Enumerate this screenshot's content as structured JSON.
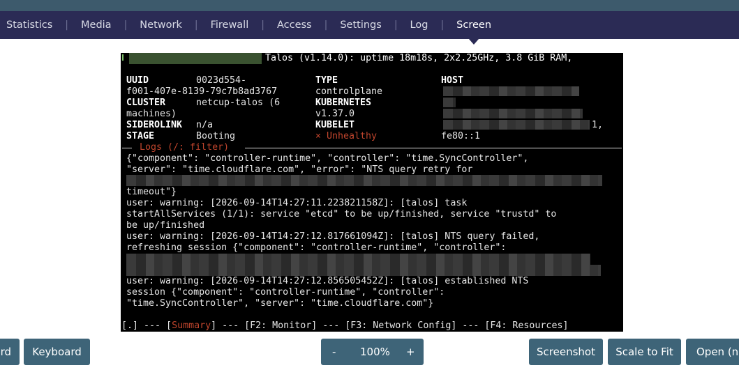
{
  "nav": {
    "items": [
      "Statistics",
      "Media",
      "Network",
      "Firewall",
      "Access",
      "Settings",
      "Log",
      "Screen"
    ],
    "active": "Screen",
    "colors": {
      "bar": "#2b2b55",
      "strip": "#3d5a6c"
    }
  },
  "console": {
    "header": "Talos (v1.14.0): uptime 18m18s, 2x2.25GHz, 3.8 GiB RAM,",
    "uuid_label": "UUID",
    "uuid_value_1": "0023d554-",
    "uuid_value_2": "f001-407e-8139-79c7b8ad3767",
    "cluster_label": "CLUSTER",
    "cluster_value_1": "netcup-talos (6",
    "cluster_value_2": "machines)",
    "siderolink_label": "SIDEROLINK",
    "siderolink_value": "n/a",
    "stage_label": "STAGE",
    "stage_value": "Booting",
    "type_label": "TYPE",
    "type_value": "controlplane",
    "kubernetes_label": "KUBERNETES",
    "kubernetes_value": "v1.37.0",
    "kubelet_label": "KUBELET",
    "kubelet_value": "× Unhealthy",
    "host_label": "HOST",
    "host_addr_suffix": "1,",
    "host_ipv6": "fe80::1",
    "logs_title": "Logs (/: filter)",
    "log_lines": [
      "{\"component\": \"controller-runtime\", \"controller\": \"time.SyncController\",",
      "\"server\": \"time.cloudflare.com\", \"error\": \"NTS query retry for",
      "timeout\"}",
      "user: warning: [2026-09-14T14:27:11.223821158Z]: [talos] task",
      "startAllServices (1/1): service \"etcd\" to be up/finished, service \"trustd\" to",
      "be up/finished",
      "user: warning: [2026-09-14T14:27:12.817661094Z]: [talos] NTS query failed,",
      "refreshing session {\"component\": \"controller-runtime\", \"controller\":",
      "user: warning: [2026-09-14T14:27:12.856505452Z]: [talos] established NTS",
      "session {\"component\": \"controller-runtime\", \"controller\":",
      "\"time.SyncController\", \"server\": \"time.cloudflare.com\"}"
    ],
    "footer_pre": "[.] --- [",
    "footer_summary": "Summary",
    "footer_post": "] --- [F2: Monitor] --- [F3: Network Config] --- [F4: Resources]"
  },
  "toolbar": {
    "left_partial_label": "rd",
    "keyboard_label": "Keyboard",
    "zoom_out": "-",
    "zoom_level": "100%",
    "zoom_in": "+",
    "screenshot_label": "Screenshot",
    "scale_label": "Scale to Fit",
    "open_label": "Open (ne",
    "color": "#3e6478"
  }
}
